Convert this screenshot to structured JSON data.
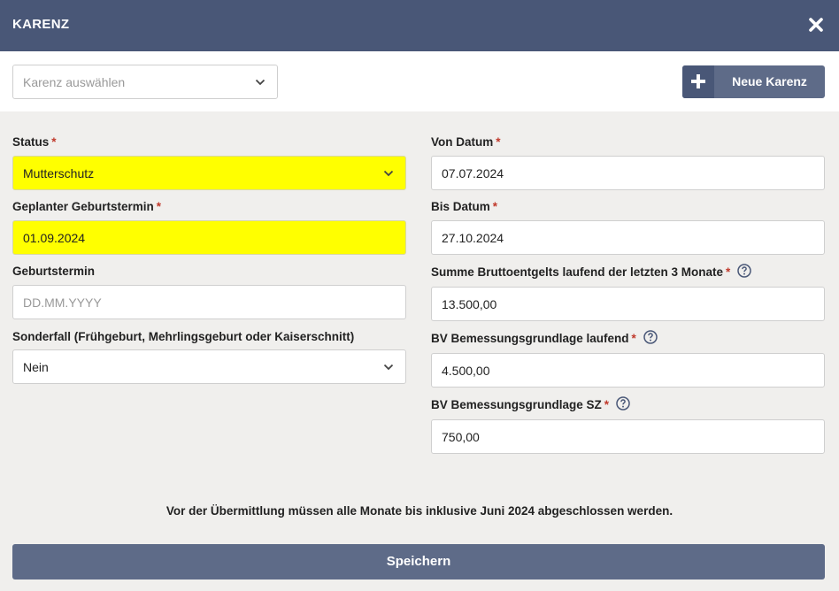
{
  "header": {
    "title": "KARENZ"
  },
  "top": {
    "karenz_select_placeholder": "Karenz auswählen",
    "new_button_label": "Neue Karenz"
  },
  "left": {
    "status": {
      "label": "Status",
      "value": "Mutterschutz",
      "required": "*"
    },
    "geplanter_geburtstermin": {
      "label": "Geplanter Geburtstermin",
      "value": "01.09.2024",
      "required": "*"
    },
    "geburtstermin": {
      "label": "Geburtstermin",
      "placeholder": "DD.MM.YYYY"
    },
    "sonderfall": {
      "label": "Sonderfall (Frühgeburt, Mehrlingsgeburt oder Kaiserschnitt)",
      "value": "Nein"
    }
  },
  "right": {
    "von_datum": {
      "label": "Von Datum",
      "value": "07.07.2024",
      "required": "*"
    },
    "bis_datum": {
      "label": "Bis Datum",
      "value": "27.10.2024",
      "required": "*"
    },
    "summe_brutto": {
      "label": "Summe Bruttoentgelts laufend der letzten 3 Monate",
      "value": "13.500,00",
      "required": "*"
    },
    "bv_laufend": {
      "label": "BV Bemessungsgrundlage laufend",
      "value": "4.500,00",
      "required": "*"
    },
    "bv_sz": {
      "label": "BV Bemessungsgrundlage SZ",
      "value": "750,00",
      "required": "*"
    }
  },
  "notice": "Vor der Übermittlung müssen alle Monate bis inklusive Juni 2024 abgeschlossen werden.",
  "save_label": "Speichern",
  "colors": {
    "header": "#495777",
    "button": "#5e6b88",
    "highlight": "#ffff00",
    "required": "#c0392b"
  }
}
